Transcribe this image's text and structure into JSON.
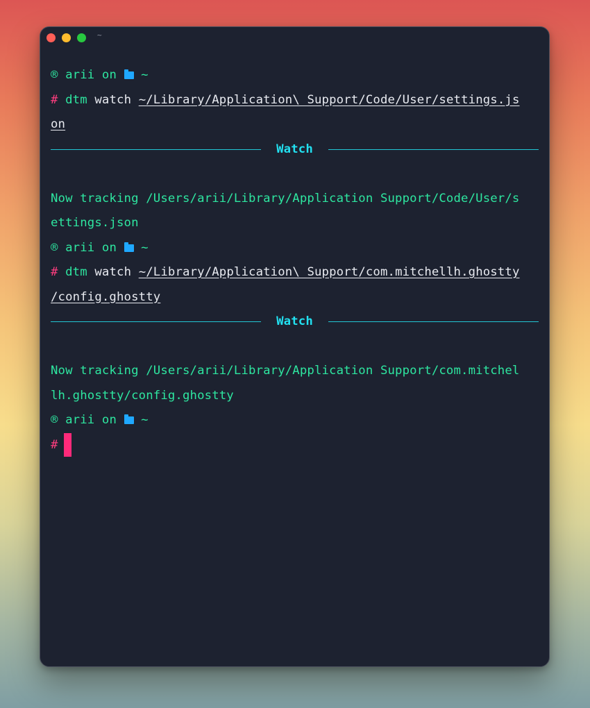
{
  "window": {
    "title": "~",
    "colors": {
      "close": "#ff5f57",
      "minimize": "#febc2e",
      "maximize": "#28c840",
      "background": "#1d2230",
      "prompt_green": "#2ee6a0",
      "hash_pink": "#ff3d7f",
      "rule_cyan": "#22c8d6",
      "cursor": "#ff2a7a"
    }
  },
  "prompt": {
    "user_symbol": "®",
    "user": "arii",
    "on": "on",
    "dir": "~",
    "hash": "#"
  },
  "blocks": [
    {
      "cmd": "dtm",
      "sub": "watch",
      "path_line1": "~/Library/Application\\ Support/Code/User/settings.js",
      "path_line2": "on",
      "section": "Watch",
      "output_line1": "Now tracking /Users/arii/Library/Application Support/Code/User/s",
      "output_line2": "ettings.json"
    },
    {
      "cmd": "dtm",
      "sub": "watch",
      "path_line1": "~/Library/Application\\ Support/com.mitchellh.ghostty",
      "path_line2": "/config.ghostty",
      "section": "Watch",
      "output_line1": "Now tracking /Users/arii/Library/Application Support/com.mitchel",
      "output_line2": "lh.ghostty/config.ghostty"
    }
  ]
}
